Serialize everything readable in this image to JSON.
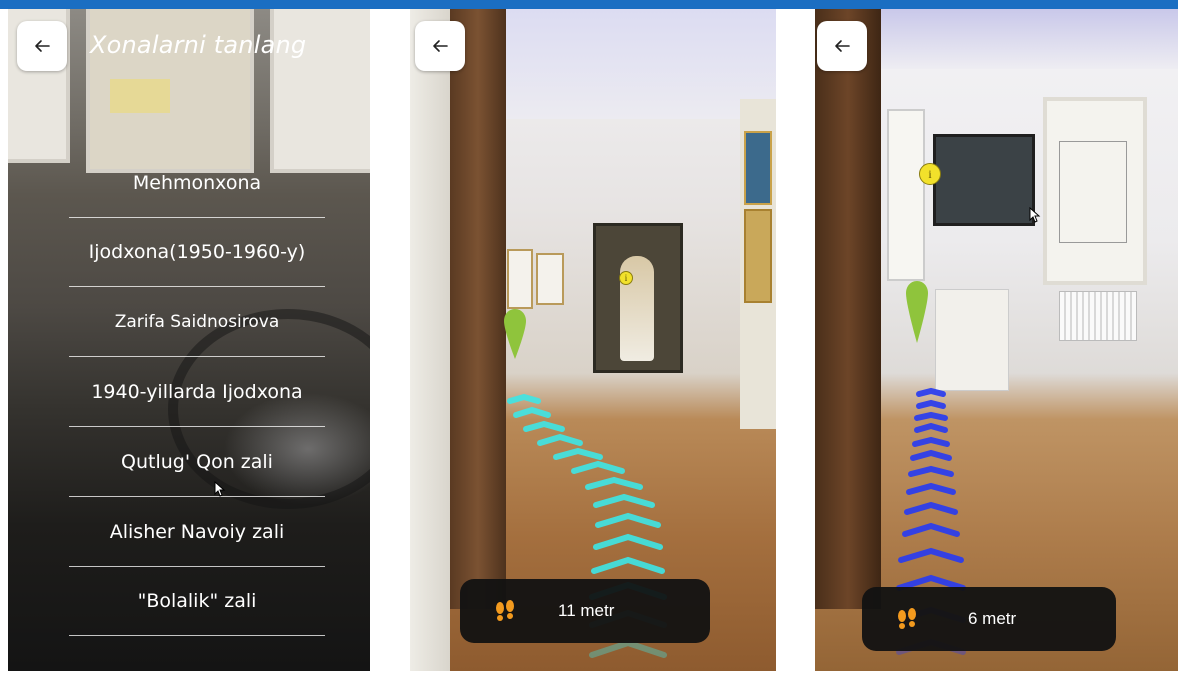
{
  "screens": {
    "room_select": {
      "title": "Xonalarni tanlang",
      "rooms": [
        {
          "label": "Mehmonxona"
        },
        {
          "label": "Ijodxona(1950-1960-y)"
        },
        {
          "label": "Zarifa Saidnosirova"
        },
        {
          "label": "1940-yillarda Ijodxona"
        },
        {
          "label": "Qutlug' Qon zali"
        },
        {
          "label": "Alisher Navoiy zali"
        },
        {
          "label": "\"Bolalik\" zali"
        }
      ]
    },
    "nav_1": {
      "distance_label": "11 metr",
      "path_color": "#3ee6e6"
    },
    "nav_2": {
      "distance_label": "6 metr",
      "path_color": "#2a3cf0"
    }
  },
  "icons": {
    "back": "arrow-left-icon",
    "footsteps": "footsteps-icon",
    "location_pin": "map-pin-icon",
    "info": "info-icon"
  },
  "colors": {
    "top_bar": "#1b6ec2",
    "footsteps": "#f39a1e",
    "pin": "#8fc43c",
    "info_marker": "#f2e12b"
  }
}
